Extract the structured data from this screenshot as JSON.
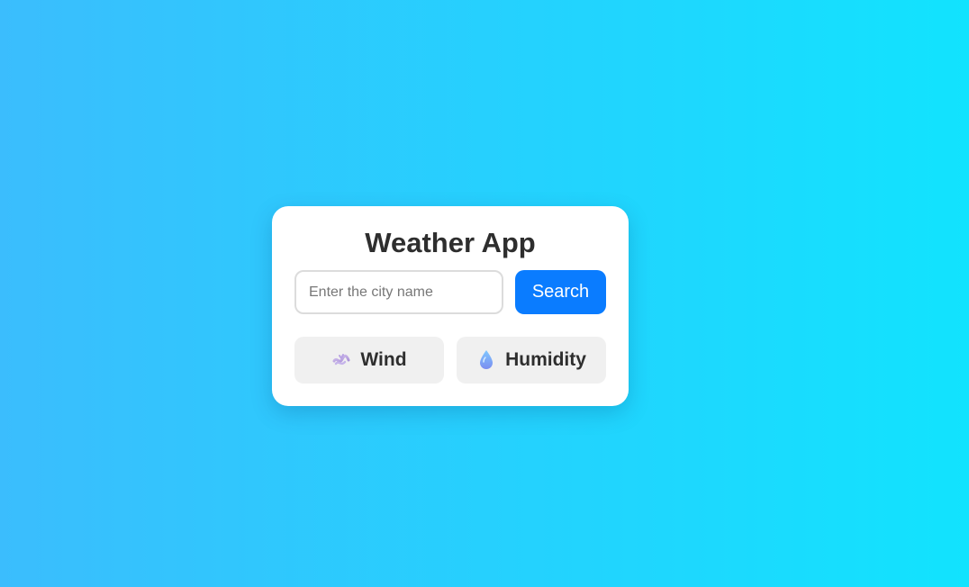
{
  "app": {
    "title": "Weather App"
  },
  "search": {
    "placeholder": "Enter the city name",
    "value": "",
    "button_label": "Search"
  },
  "metrics": [
    {
      "label": "Wind",
      "icon": "wind-icon"
    },
    {
      "label": "Humidity",
      "icon": "droplet-icon"
    }
  ],
  "colors": {
    "background_start": "#3bbdfd",
    "background_end": "#11e3fe",
    "accent": "#0a7cff",
    "card": "#ffffff",
    "metric_bg": "#f0f0f0",
    "text": "#2e2e2e"
  }
}
